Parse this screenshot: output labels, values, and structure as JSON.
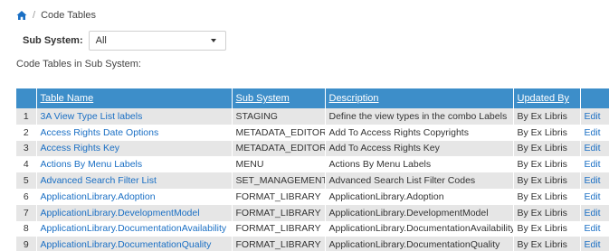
{
  "breadcrumb": {
    "separator": "/",
    "title": "Code Tables",
    "home_icon": "home-icon"
  },
  "filter": {
    "label": "Sub System:",
    "selected": "All"
  },
  "section_label": "Code Tables in Sub System:",
  "table": {
    "headers": {
      "num": "",
      "table_name": "Table Name",
      "sub_system": "Sub System",
      "description": "Description",
      "updated_by": "Updated By",
      "action": ""
    },
    "rows": [
      {
        "num": "1",
        "table_name": "3A View Type List labels",
        "sub_system": "STAGING",
        "description": "Define the view types in the combo Labels",
        "updated_by": "By Ex Libris",
        "action": "Edit"
      },
      {
        "num": "2",
        "table_name": "Access Rights Date Options",
        "sub_system": "METADATA_EDITOR",
        "description": "Add To Access Rights Copyrights",
        "updated_by": "By Ex Libris",
        "action": "Edit"
      },
      {
        "num": "3",
        "table_name": "Access Rights Key",
        "sub_system": "METADATA_EDITOR",
        "description": "Add To Access Rights Key",
        "updated_by": "By Ex Libris",
        "action": "Edit"
      },
      {
        "num": "4",
        "table_name": "Actions By Menu Labels",
        "sub_system": "MENU",
        "description": "Actions By Menu Labels",
        "updated_by": "By Ex Libris",
        "action": "Edit"
      },
      {
        "num": "5",
        "table_name": "Advanced Search Filter List",
        "sub_system": "SET_MANAGEMENT",
        "description": "Advanced Search List Filter Codes",
        "updated_by": "By Ex Libris",
        "action": "Edit"
      },
      {
        "num": "6",
        "table_name": "ApplicationLibrary.Adoption",
        "sub_system": "FORMAT_LIBRARY",
        "description": "ApplicationLibrary.Adoption",
        "updated_by": "By Ex Libris",
        "action": "Edit"
      },
      {
        "num": "7",
        "table_name": "ApplicationLibrary.DevelopmentModel",
        "sub_system": "FORMAT_LIBRARY",
        "description": "ApplicationLibrary.DevelopmentModel",
        "updated_by": "By Ex Libris",
        "action": "Edit"
      },
      {
        "num": "8",
        "table_name": "ApplicationLibrary.DocumentationAvailability",
        "sub_system": "FORMAT_LIBRARY",
        "description": "ApplicationLibrary.DocumentationAvailability",
        "updated_by": "By Ex Libris",
        "action": "Edit"
      },
      {
        "num": "9",
        "table_name": "ApplicationLibrary.DocumentationQuality",
        "sub_system": "FORMAT_LIBRARY",
        "description": "ApplicationLibrary.DocumentationQuality",
        "updated_by": "By Ex Libris",
        "action": "Edit"
      }
    ]
  },
  "colors": {
    "header_bg": "#3d8ec9",
    "link": "#1a6fc4",
    "row_stripe": "#e6e6e6"
  }
}
